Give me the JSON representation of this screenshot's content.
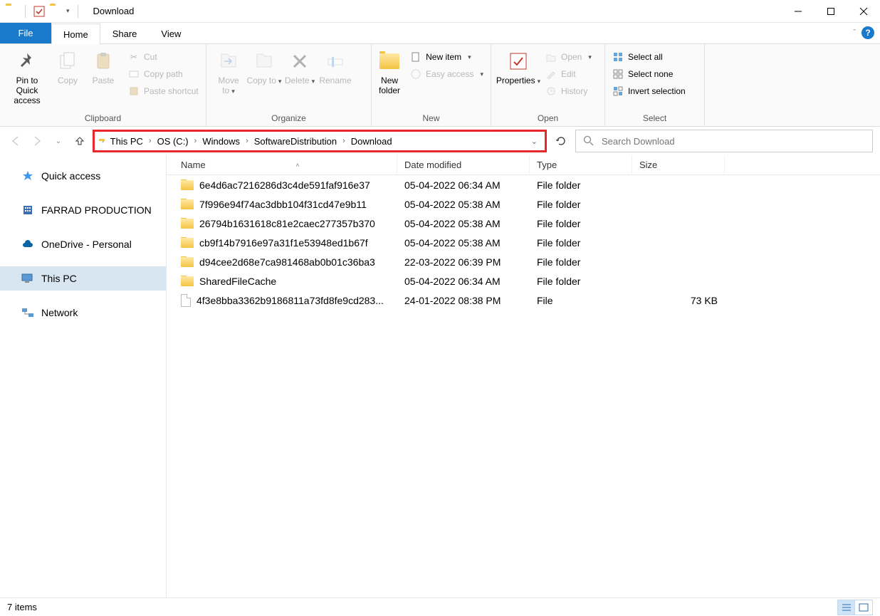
{
  "window": {
    "title": "Download"
  },
  "tabs": {
    "file": "File",
    "home": "Home",
    "share": "Share",
    "view": "View"
  },
  "ribbon": {
    "groups": {
      "clipboard": "Clipboard",
      "organize": "Organize",
      "new": "New",
      "open": "Open",
      "select": "Select"
    },
    "pin": "Pin to Quick access",
    "copy": "Copy",
    "paste": "Paste",
    "cut": "Cut",
    "copy_path": "Copy path",
    "paste_shortcut": "Paste shortcut",
    "move_to": "Move to",
    "copy_to": "Copy to",
    "delete": "Delete",
    "rename": "Rename",
    "new_folder": "New folder",
    "new_item": "New item",
    "easy_access": "Easy access",
    "properties": "Properties",
    "open_cmd": "Open",
    "edit": "Edit",
    "history": "History",
    "select_all": "Select all",
    "select_none": "Select none",
    "invert_selection": "Invert selection"
  },
  "breadcrumb": {
    "items": [
      "This PC",
      "OS (C:)",
      "Windows",
      "SoftwareDistribution",
      "Download"
    ]
  },
  "search": {
    "placeholder": "Search Download"
  },
  "sidebar": {
    "quick_access": "Quick access",
    "farrad": "FARRAD PRODUCTION",
    "onedrive": "OneDrive - Personal",
    "this_pc": "This PC",
    "network": "Network"
  },
  "columns": {
    "name": "Name",
    "date": "Date modified",
    "type": "Type",
    "size": "Size"
  },
  "files": [
    {
      "name": "6e4d6ac7216286d3c4de591faf916e37",
      "date": "05-04-2022 06:34 AM",
      "type": "File folder",
      "size": "",
      "kind": "folder"
    },
    {
      "name": "7f996e94f74ac3dbb104f31cd47e9b11",
      "date": "05-04-2022 05:38 AM",
      "type": "File folder",
      "size": "",
      "kind": "folder"
    },
    {
      "name": "26794b1631618c81e2caec277357b370",
      "date": "05-04-2022 05:38 AM",
      "type": "File folder",
      "size": "",
      "kind": "folder"
    },
    {
      "name": "cb9f14b7916e97a31f1e53948ed1b67f",
      "date": "05-04-2022 05:38 AM",
      "type": "File folder",
      "size": "",
      "kind": "folder"
    },
    {
      "name": "d94cee2d68e7ca981468ab0b01c36ba3",
      "date": "22-03-2022 06:39 PM",
      "type": "File folder",
      "size": "",
      "kind": "folder"
    },
    {
      "name": "SharedFileCache",
      "date": "05-04-2022 06:34 AM",
      "type": "File folder",
      "size": "",
      "kind": "folder"
    },
    {
      "name": "4f3e8bba3362b9186811a73fd8fe9cd283...",
      "date": "24-01-2022 08:38 PM",
      "type": "File",
      "size": "73 KB",
      "kind": "file"
    }
  ],
  "status": {
    "items": "7 items"
  }
}
